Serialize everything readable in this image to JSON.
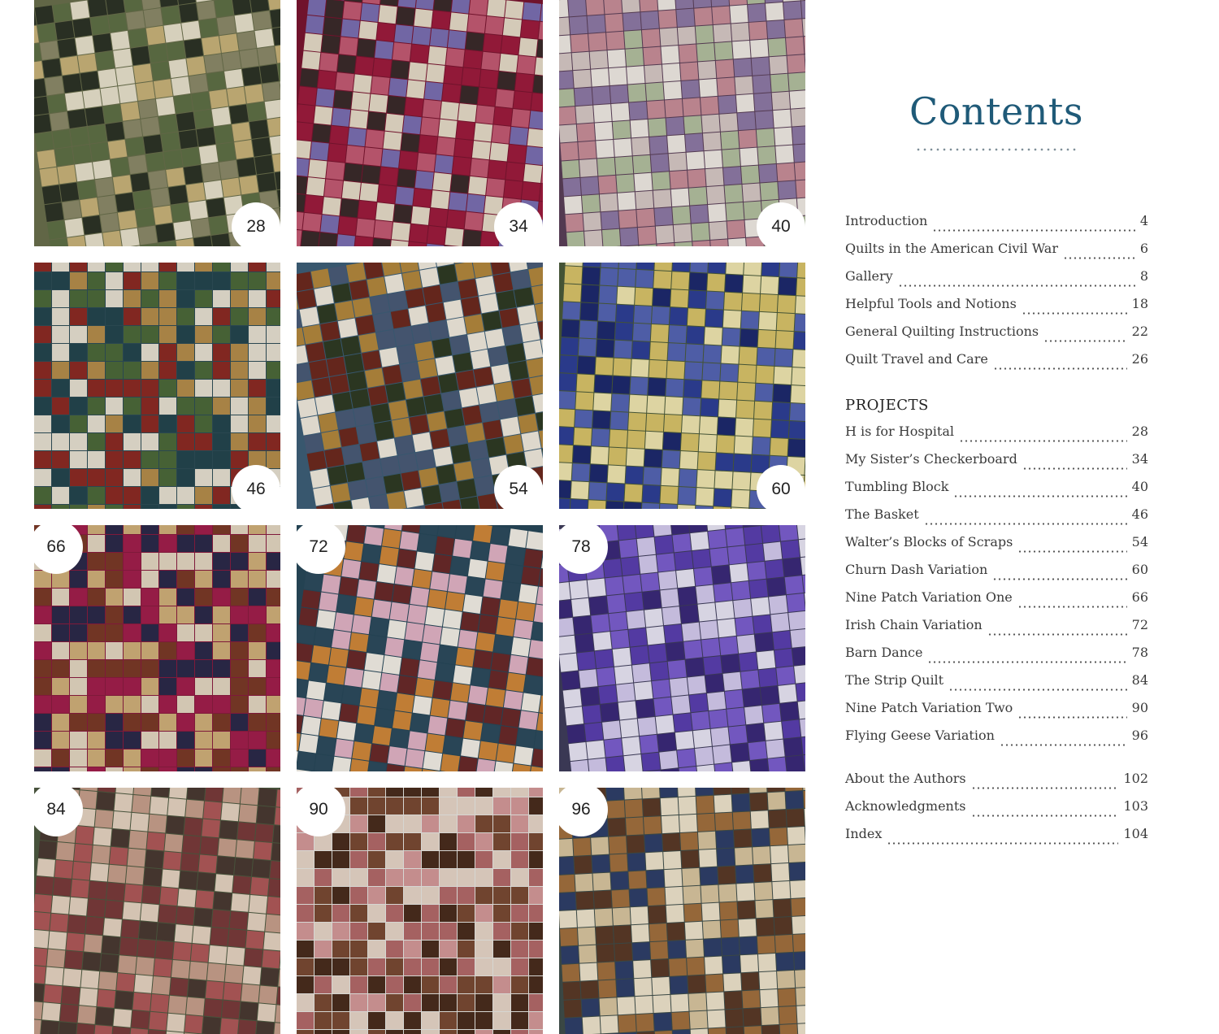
{
  "contents": {
    "title": "Contents",
    "intro_entries": [
      {
        "label": "Introduction",
        "page": "4"
      },
      {
        "label": "Quilts in the American Civil War",
        "page": "6"
      },
      {
        "label": "Gallery",
        "page": "8"
      },
      {
        "label": "Helpful Tools and Notions",
        "page": "18"
      },
      {
        "label": "General Quilting Instructions",
        "page": "22"
      },
      {
        "label": "Quilt Travel and Care",
        "page": "26"
      }
    ],
    "projects_heading": "PROJECTS",
    "project_entries": [
      {
        "label": "H is for Hospital",
        "page": "28"
      },
      {
        "label": "My Sister’s Checkerboard",
        "page": "34"
      },
      {
        "label": "Tumbling Block",
        "page": "40"
      },
      {
        "label": "The Basket",
        "page": "46"
      },
      {
        "label": "Walter’s Blocks of Scraps",
        "page": "54"
      },
      {
        "label": "Churn Dash Variation",
        "page": "60"
      },
      {
        "label": "Nine Patch Variation One",
        "page": "66"
      },
      {
        "label": "Irish Chain Variation",
        "page": "72"
      },
      {
        "label": "Barn Dance",
        "page": "78"
      },
      {
        "label": "The Strip Quilt",
        "page": "84"
      },
      {
        "label": "Nine Patch Variation Two",
        "page": "90"
      },
      {
        "label": "Flying Geese Variation",
        "page": "96"
      }
    ],
    "end_entries": [
      {
        "label": "About the Authors",
        "page": "102"
      },
      {
        "label": "Acknowledgments",
        "page": "103"
      },
      {
        "label": "Index",
        "page": "104"
      }
    ]
  },
  "gallery": [
    {
      "page": "28",
      "badge_corner": "bottom-right",
      "palette": [
        "#5f7046",
        "#e9e2cc",
        "#2d3326",
        "#c9b37a",
        "#8c8a6a"
      ],
      "backdrop": "#6a6f4c"
    },
    {
      "page": "34",
      "badge_corner": "bottom-right",
      "palette": [
        "#9e1c3d",
        "#e7dcc8",
        "#7b6fb2",
        "#3b2b2b",
        "#c45b73"
      ],
      "backdrop": "#7a1530"
    },
    {
      "page": "40",
      "badge_corner": "bottom-right",
      "palette": [
        "#d7c9c6",
        "#8f7aa7",
        "#c98f9a",
        "#b4c0a0",
        "#f0ebe4"
      ],
      "backdrop": "#5b3f58"
    },
    {
      "page": "46",
      "badge_corner": "bottom-right",
      "palette": [
        "#8c2b24",
        "#e8e1d2",
        "#4c6a3a",
        "#b68e4b",
        "#24464f"
      ],
      "backdrop": "#2e4e57"
    },
    {
      "page": "54",
      "badge_corner": "bottom-right",
      "palette": [
        "#f1ebde",
        "#6d2a1f",
        "#2f3b24",
        "#b3883d",
        "#4a5c78"
      ],
      "backdrop": "#3d5f78"
    },
    {
      "page": "60",
      "badge_corner": "bottom-right",
      "palette": [
        "#2e3f96",
        "#d9c46a",
        "#5565b5",
        "#f0e6b0",
        "#1e2a6e"
      ],
      "backdrop": "#4a5b3a"
    },
    {
      "page": "66",
      "badge_corner": "top-left",
      "palette": [
        "#a21f4c",
        "#d1b07a",
        "#2c2a4a",
        "#e4d7c2",
        "#7b3a28"
      ],
      "backdrop": "#8a1c3f"
    },
    {
      "page": "72",
      "badge_corner": "top-left",
      "palette": [
        "#f4efe6",
        "#6a2a2a",
        "#d1883a",
        "#e2b3c6",
        "#2d4b5e"
      ],
      "backdrop": "#28485a"
    },
    {
      "page": "78",
      "badge_corner": "top-left",
      "palette": [
        "#5b3fb0",
        "#d5cbef",
        "#7c5fd0",
        "#3b2a7a",
        "#eae6f6"
      ],
      "backdrop": "#3f3d5c"
    },
    {
      "page": "84",
      "badge_corner": "top-left",
      "palette": [
        "#c8a08c",
        "#7a3b3b",
        "#e6d4c2",
        "#4a3a32",
        "#b05a5a"
      ],
      "backdrop": "#4e5a40"
    },
    {
      "page": "90",
      "badge_corner": "top-left",
      "palette": [
        "#4a2d1e",
        "#d59a9a",
        "#e8d6c8",
        "#7a4a34",
        "#b46a6a"
      ],
      "backdrop": "#e9e9e4"
    },
    {
      "page": "96",
      "badge_corner": "top-left",
      "palette": [
        "#d9c6a0",
        "#5b3a28",
        "#2f3f6a",
        "#a2703e",
        "#efe4cc"
      ],
      "backdrop": "#3f4e4a"
    }
  ]
}
